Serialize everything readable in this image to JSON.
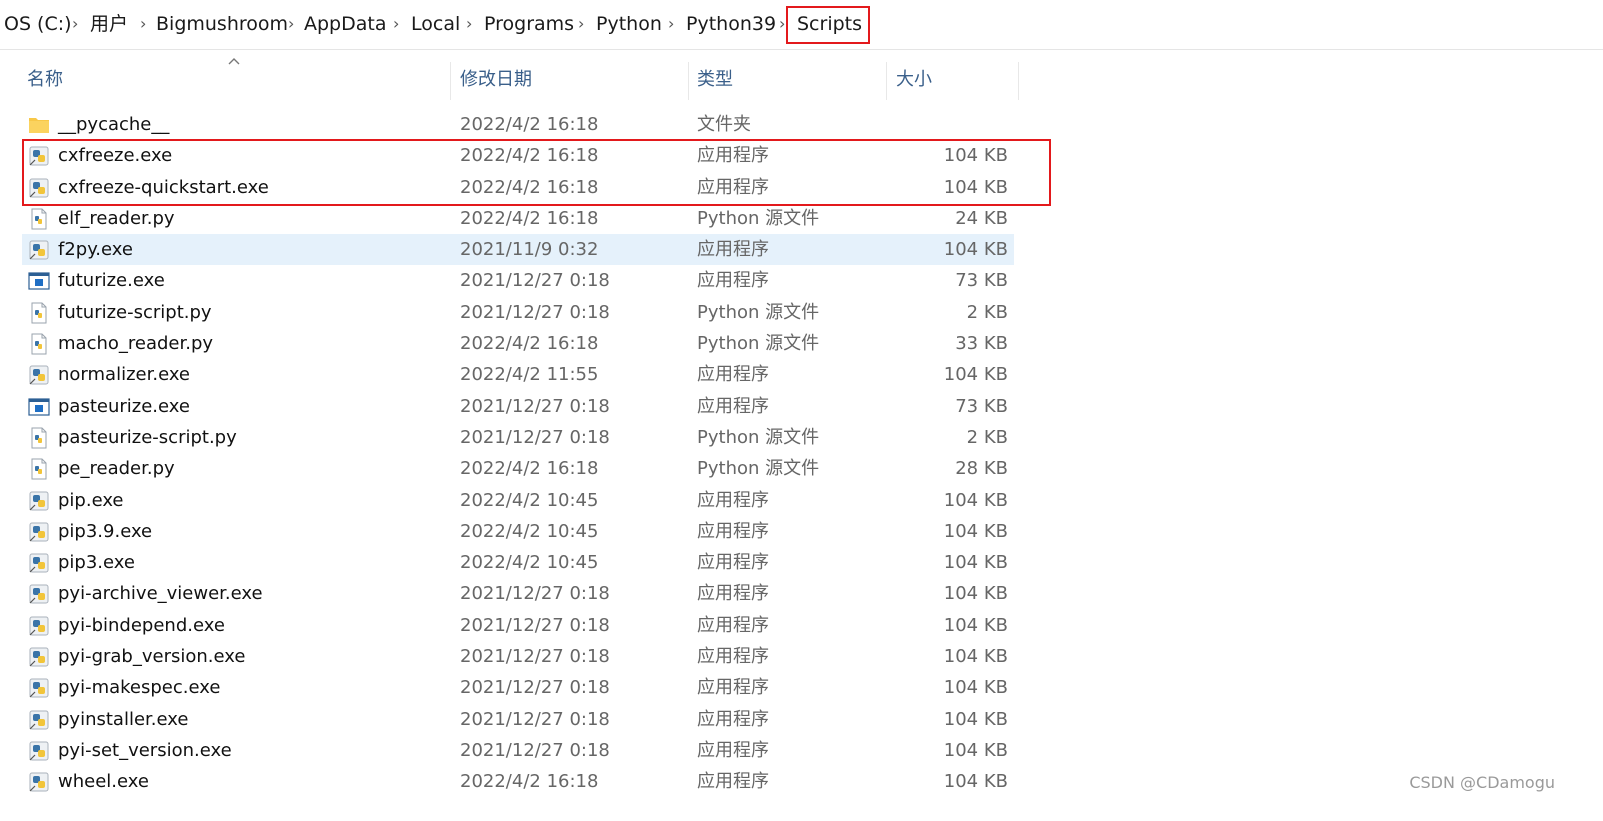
{
  "breadcrumb": [
    "OS (C:)",
    "用户",
    "Bigmushroom",
    "AppData",
    "Local",
    "Programs",
    "Python",
    "Python39",
    "Scripts"
  ],
  "breadcrumb_separator": "›",
  "columns": {
    "name": "名称",
    "date": "修改日期",
    "type": "类型",
    "size": "大小"
  },
  "files": [
    {
      "name": "__pycache__",
      "date": "2022/4/2 16:18",
      "type": "文件夹",
      "size": "",
      "icon": "folder-icon"
    },
    {
      "name": "cxfreeze.exe",
      "date": "2022/4/2 16:18",
      "type": "应用程序",
      "size": "104 KB",
      "icon": "python-exe-icon"
    },
    {
      "name": "cxfreeze-quickstart.exe",
      "date": "2022/4/2 16:18",
      "type": "应用程序",
      "size": "104 KB",
      "icon": "python-exe-icon"
    },
    {
      "name": "elf_reader.py",
      "date": "2022/4/2 16:18",
      "type": "Python 源文件",
      "size": "24 KB",
      "icon": "python-file-icon"
    },
    {
      "name": "f2py.exe",
      "date": "2021/11/9 0:32",
      "type": "应用程序",
      "size": "104 KB",
      "icon": "python-exe-icon"
    },
    {
      "name": "futurize.exe",
      "date": "2021/12/27 0:18",
      "type": "应用程序",
      "size": "73 KB",
      "icon": "window-exe-icon"
    },
    {
      "name": "futurize-script.py",
      "date": "2021/12/27 0:18",
      "type": "Python 源文件",
      "size": "2 KB",
      "icon": "python-file-icon"
    },
    {
      "name": "macho_reader.py",
      "date": "2022/4/2 16:18",
      "type": "Python 源文件",
      "size": "33 KB",
      "icon": "python-file-icon"
    },
    {
      "name": "normalizer.exe",
      "date": "2022/4/2 11:55",
      "type": "应用程序",
      "size": "104 KB",
      "icon": "python-exe-icon"
    },
    {
      "name": "pasteurize.exe",
      "date": "2021/12/27 0:18",
      "type": "应用程序",
      "size": "73 KB",
      "icon": "window-exe-icon"
    },
    {
      "name": "pasteurize-script.py",
      "date": "2021/12/27 0:18",
      "type": "Python 源文件",
      "size": "2 KB",
      "icon": "python-file-icon"
    },
    {
      "name": "pe_reader.py",
      "date": "2022/4/2 16:18",
      "type": "Python 源文件",
      "size": "28 KB",
      "icon": "python-file-icon"
    },
    {
      "name": "pip.exe",
      "date": "2022/4/2 10:45",
      "type": "应用程序",
      "size": "104 KB",
      "icon": "python-exe-icon"
    },
    {
      "name": "pip3.9.exe",
      "date": "2022/4/2 10:45",
      "type": "应用程序",
      "size": "104 KB",
      "icon": "python-exe-icon"
    },
    {
      "name": "pip3.exe",
      "date": "2022/4/2 10:45",
      "type": "应用程序",
      "size": "104 KB",
      "icon": "python-exe-icon"
    },
    {
      "name": "pyi-archive_viewer.exe",
      "date": "2021/12/27 0:18",
      "type": "应用程序",
      "size": "104 KB",
      "icon": "python-exe-icon"
    },
    {
      "name": "pyi-bindepend.exe",
      "date": "2021/12/27 0:18",
      "type": "应用程序",
      "size": "104 KB",
      "icon": "python-exe-icon"
    },
    {
      "name": "pyi-grab_version.exe",
      "date": "2021/12/27 0:18",
      "type": "应用程序",
      "size": "104 KB",
      "icon": "python-exe-icon"
    },
    {
      "name": "pyi-makespec.exe",
      "date": "2021/12/27 0:18",
      "type": "应用程序",
      "size": "104 KB",
      "icon": "python-exe-icon"
    },
    {
      "name": "pyinstaller.exe",
      "date": "2021/12/27 0:18",
      "type": "应用程序",
      "size": "104 KB",
      "icon": "python-exe-icon"
    },
    {
      "name": "pyi-set_version.exe",
      "date": "2021/12/27 0:18",
      "type": "应用程序",
      "size": "104 KB",
      "icon": "python-exe-icon"
    },
    {
      "name": "wheel.exe",
      "date": "2022/4/2 16:18",
      "type": "应用程序",
      "size": "104 KB",
      "icon": "python-exe-icon"
    }
  ],
  "selected_index": 4,
  "watermark": "CSDN @CDamogu",
  "colors": {
    "annotation_red": "#e3191c",
    "selection": "#e5f1fb",
    "header_text": "#3a5f8a"
  }
}
